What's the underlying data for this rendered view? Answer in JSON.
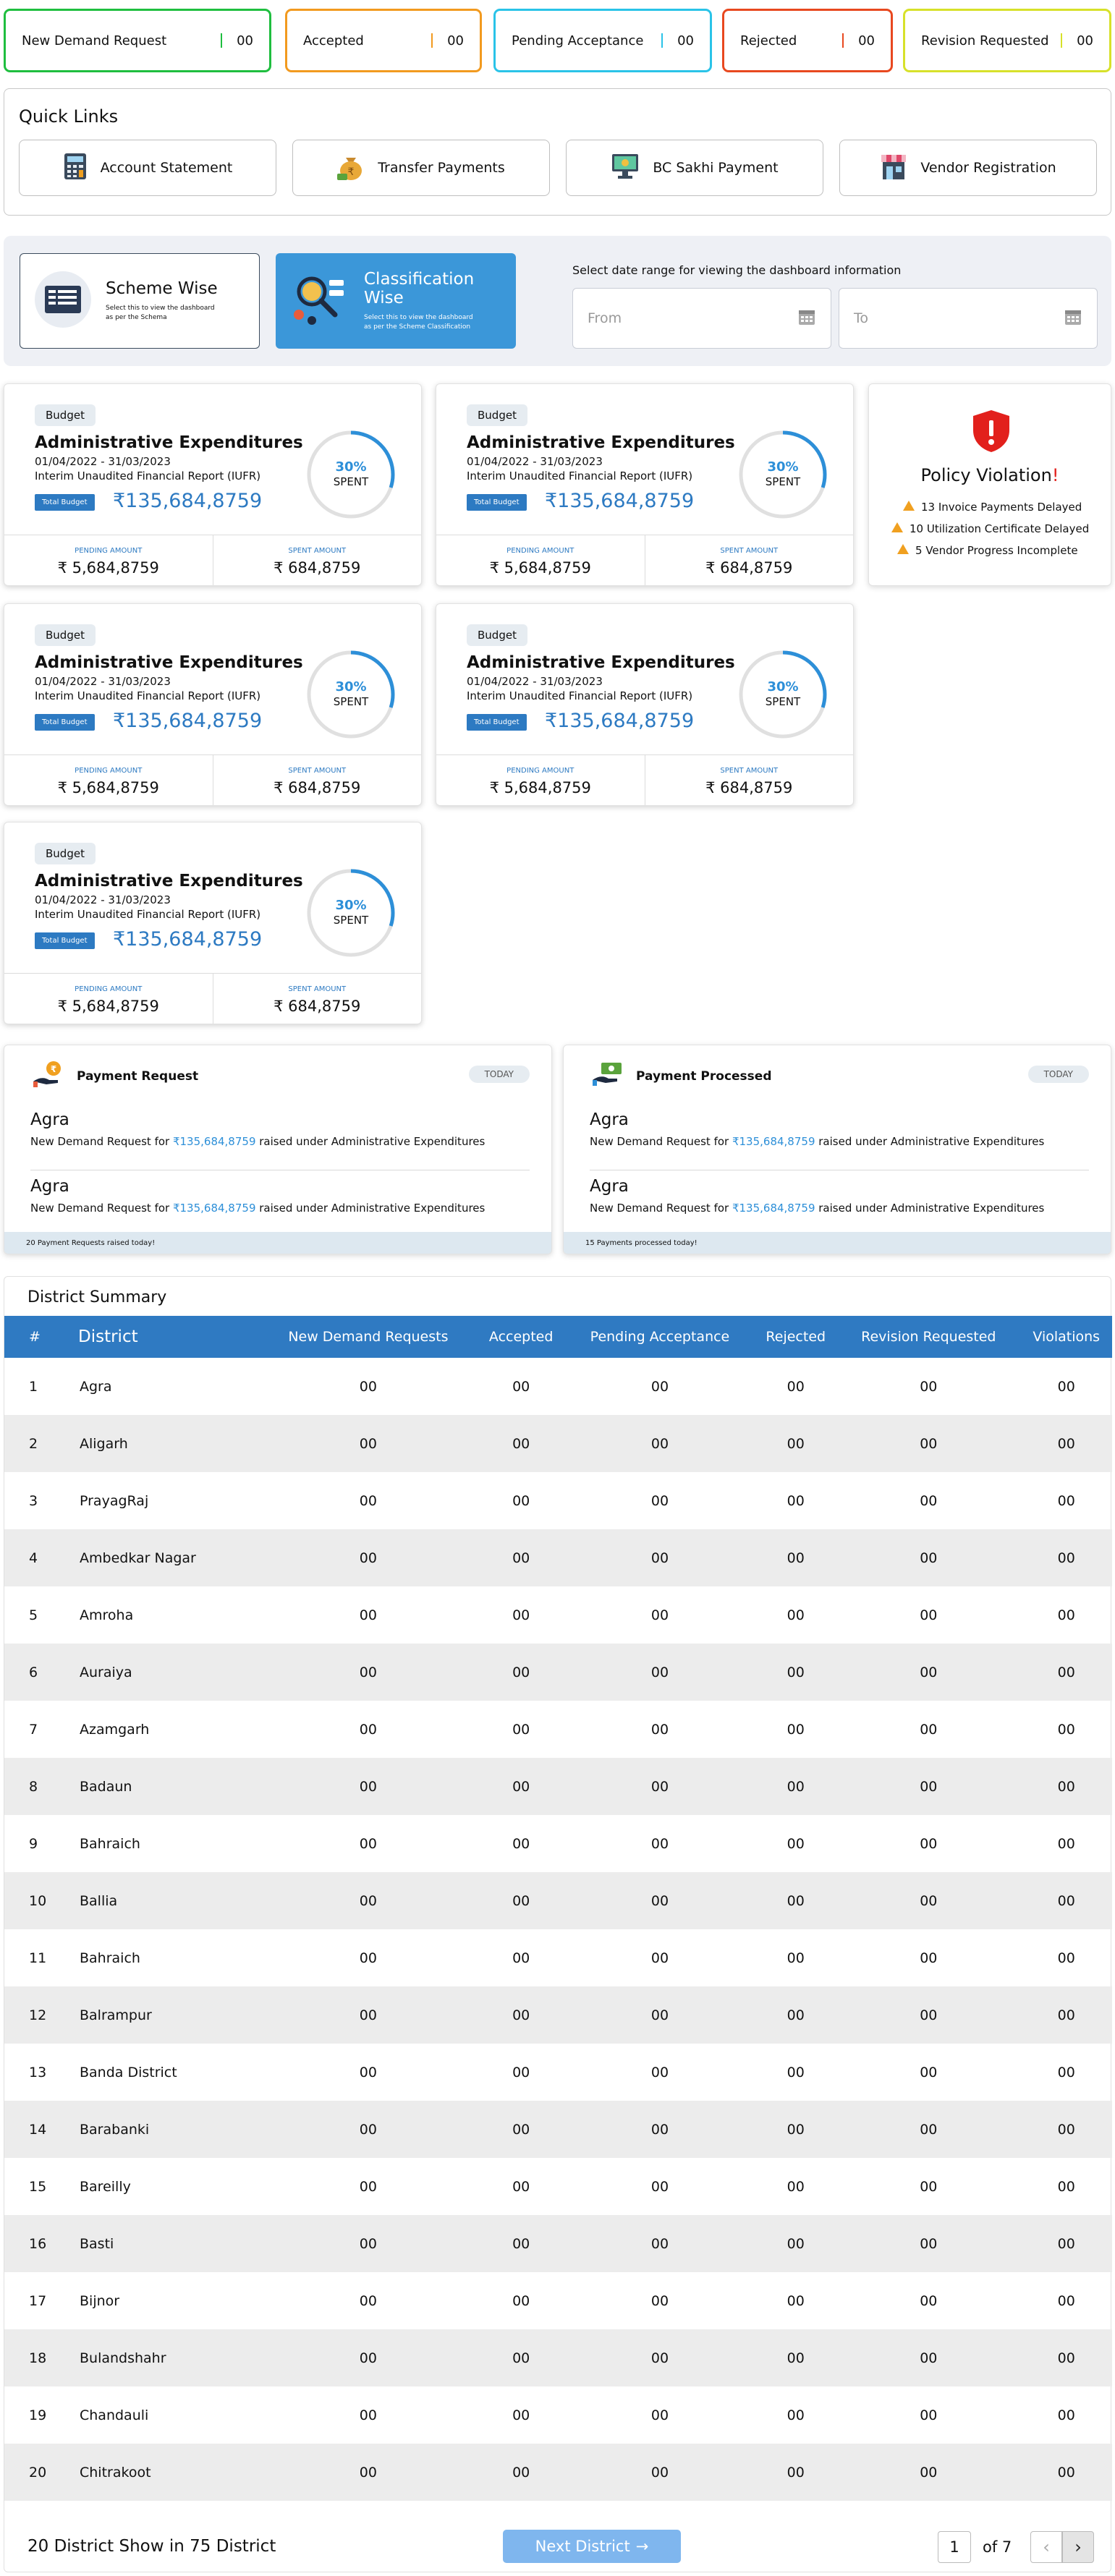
{
  "status_cards": [
    {
      "label": "New Demand Request",
      "count": "00",
      "color": "#1fbe3f"
    },
    {
      "label": "Accepted",
      "count": "00",
      "color": "#f29a1f"
    },
    {
      "label": "Pending Acceptance",
      "count": "00",
      "color": "#2ac3e8"
    },
    {
      "label": "Rejected",
      "count": "00",
      "color": "#e8481f"
    },
    {
      "label": "Revision Requested",
      "count": "00",
      "color": "#d7e12a"
    }
  ],
  "quick_links": {
    "title": "Quick Links",
    "items": [
      {
        "label": "Account Statement",
        "icon": "calculator-icon"
      },
      {
        "label": "Transfer Payments",
        "icon": "money-bag-icon"
      },
      {
        "label": "BC Sakhi Payment",
        "icon": "monitor-icon"
      },
      {
        "label": "Vendor Registration",
        "icon": "store-icon"
      }
    ]
  },
  "view_toggle": {
    "scheme": {
      "title": "Scheme Wise",
      "subtitle": "Select this to view the dashboard as per the Schema"
    },
    "classification": {
      "title": "Classification Wise",
      "subtitle": "Select this to view the dashboard as per the Scheme Classification"
    }
  },
  "date_range": {
    "label": "Select date range for viewing the dashboard information",
    "from_placeholder": "From",
    "to_placeholder": "To"
  },
  "budget_cards": [
    {
      "tag": "Budget",
      "title": "Administrative Expenditures",
      "dates": "01/04/2022 - 31/03/2023",
      "report": "Interim Unaudited Financial Report (IUFR)",
      "total_label": "Total Budget",
      "total": "₹135,684,8759",
      "percent": "30%",
      "spent_label": "SPENT",
      "spent_fraction": 0.3,
      "pending_label": "PENDING AMOUNT",
      "pending": "₹ 5,684,8759",
      "spent_amount_label": "SPENT AMOUNT",
      "spent_amount": "₹ 684,8759"
    },
    {
      "tag": "Budget",
      "title": "Administrative Expenditures",
      "dates": "01/04/2022 - 31/03/2023",
      "report": "Interim Unaudited Financial Report (IUFR)",
      "total_label": "Total Budget",
      "total": "₹135,684,8759",
      "percent": "30%",
      "spent_label": "SPENT",
      "spent_fraction": 0.3,
      "pending_label": "PENDING AMOUNT",
      "pending": "₹ 5,684,8759",
      "spent_amount_label": "SPENT AMOUNT",
      "spent_amount": "₹ 684,8759"
    },
    {
      "tag": "Budget",
      "title": "Administrative Expenditures",
      "dates": "01/04/2022 - 31/03/2023",
      "report": "Interim Unaudited Financial Report (IUFR)",
      "total_label": "Total Budget",
      "total": "₹135,684,8759",
      "percent": "30%",
      "spent_label": "SPENT",
      "spent_fraction": 0.3,
      "pending_label": "PENDING AMOUNT",
      "pending": "₹ 5,684,8759",
      "spent_amount_label": "SPENT AMOUNT",
      "spent_amount": "₹ 684,8759"
    },
    {
      "tag": "Budget",
      "title": "Administrative Expenditures",
      "dates": "01/04/2022 - 31/03/2023",
      "report": "Interim Unaudited Financial Report (IUFR)",
      "total_label": "Total Budget",
      "total": "₹135,684,8759",
      "percent": "30%",
      "spent_label": "SPENT",
      "spent_fraction": 0.3,
      "pending_label": "PENDING AMOUNT",
      "pending": "₹ 5,684,8759",
      "spent_amount_label": "SPENT AMOUNT",
      "spent_amount": "₹ 684,8759"
    },
    {
      "tag": "Budget",
      "title": "Administrative Expenditures",
      "dates": "01/04/2022 - 31/03/2023",
      "report": "Interim Unaudited Financial Report (IUFR)",
      "total_label": "Total Budget",
      "total": "₹135,684,8759",
      "percent": "30%",
      "spent_label": "SPENT",
      "spent_fraction": 0.3,
      "pending_label": "PENDING AMOUNT",
      "pending": "₹ 5,684,8759",
      "spent_amount_label": "SPENT AMOUNT",
      "spent_amount": "₹ 684,8759"
    }
  ],
  "policy": {
    "title": "Policy Violation",
    "exclaim": "!",
    "items": [
      "13 Invoice Payments Delayed",
      "10 Utilization Certificate Delayed",
      "5 Vendor Progress Incomplete"
    ]
  },
  "payment_request": {
    "title": "Payment Request",
    "badge": "TODAY",
    "items": [
      {
        "city": "Agra",
        "prefix": "New Demand Request for ",
        "amount": "₹135,684,8759",
        "suffix": " raised under Administrative Expenditures"
      },
      {
        "city": "Agra",
        "prefix": "New Demand Request for ",
        "amount": "₹135,684,8759",
        "suffix": " raised under Administrative Expenditures"
      }
    ],
    "footer": "20 Payment Requests raised today!"
  },
  "payment_processed": {
    "title": "Payment Processed",
    "badge": "TODAY",
    "items": [
      {
        "city": "Agra",
        "prefix": "New Demand Request for ",
        "amount": "₹135,684,8759",
        "suffix": " raised under Administrative Expenditures"
      },
      {
        "city": "Agra",
        "prefix": "New Demand Request for ",
        "amount": "₹135,684,8759",
        "suffix": " raised under Administrative Expenditures"
      }
    ],
    "footer": "15 Payments processed today!"
  },
  "district_summary": {
    "title": "District Summary",
    "columns": [
      "#",
      "District",
      "New Demand Requests",
      "Accepted",
      "Pending Acceptance",
      "Rejected",
      "Revision Requested",
      "Violations"
    ],
    "rows": [
      [
        "1",
        "Agra",
        "00",
        "00",
        "00",
        "00",
        "00",
        "00"
      ],
      [
        "2",
        "Aligarh",
        "00",
        "00",
        "00",
        "00",
        "00",
        "00"
      ],
      [
        "3",
        "PrayagRaj",
        "00",
        "00",
        "00",
        "00",
        "00",
        "00"
      ],
      [
        "4",
        "Ambedkar Nagar",
        "00",
        "00",
        "00",
        "00",
        "00",
        "00"
      ],
      [
        "5",
        "Amroha",
        "00",
        "00",
        "00",
        "00",
        "00",
        "00"
      ],
      [
        "6",
        "Auraiya",
        "00",
        "00",
        "00",
        "00",
        "00",
        "00"
      ],
      [
        "7",
        "Azamgarh",
        "00",
        "00",
        "00",
        "00",
        "00",
        "00"
      ],
      [
        "8",
        "Badaun",
        "00",
        "00",
        "00",
        "00",
        "00",
        "00"
      ],
      [
        "9",
        "Bahraich",
        "00",
        "00",
        "00",
        "00",
        "00",
        "00"
      ],
      [
        "10",
        "Ballia",
        "00",
        "00",
        "00",
        "00",
        "00",
        "00"
      ],
      [
        "11",
        "Bahraich",
        "00",
        "00",
        "00",
        "00",
        "00",
        "00"
      ],
      [
        "12",
        "Balrampur",
        "00",
        "00",
        "00",
        "00",
        "00",
        "00"
      ],
      [
        "13",
        "Banda District",
        "00",
        "00",
        "00",
        "00",
        "00",
        "00"
      ],
      [
        "14",
        "Barabanki",
        "00",
        "00",
        "00",
        "00",
        "00",
        "00"
      ],
      [
        "15",
        "Bareilly",
        "00",
        "00",
        "00",
        "00",
        "00",
        "00"
      ],
      [
        "16",
        "Basti",
        "00",
        "00",
        "00",
        "00",
        "00",
        "00"
      ],
      [
        "17",
        "Bijnor",
        "00",
        "00",
        "00",
        "00",
        "00",
        "00"
      ],
      [
        "18",
        "Bulandshahr",
        "00",
        "00",
        "00",
        "00",
        "00",
        "00"
      ],
      [
        "19",
        "Chandauli",
        "00",
        "00",
        "00",
        "00",
        "00",
        "00"
      ],
      [
        "20",
        "Chitrakoot",
        "00",
        "00",
        "00",
        "00",
        "00",
        "00"
      ]
    ],
    "footer_text": "20 District Show in 75 District",
    "next_label": "Next District",
    "page": "1",
    "of_pages": "of 7"
  }
}
